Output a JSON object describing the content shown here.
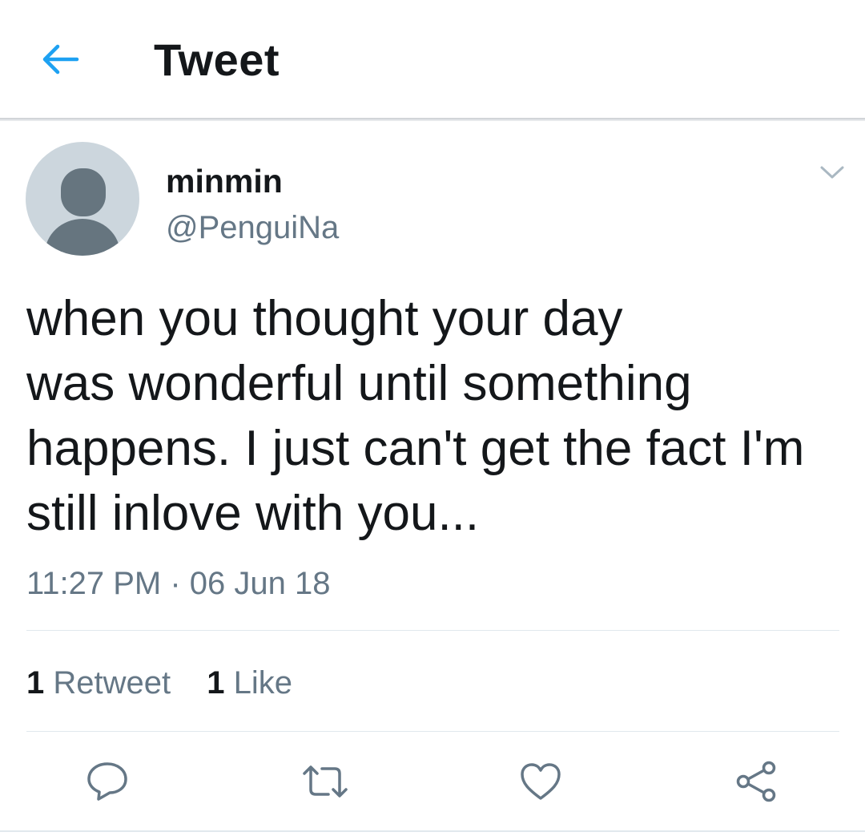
{
  "header": {
    "title": "Tweet",
    "back_icon": "arrow-left-icon",
    "accent_color": "#1da1f2"
  },
  "tweet": {
    "author": {
      "display_name": "minmin",
      "handle": "@PenguiNa",
      "avatar_icon": "default-profile-silhouette"
    },
    "menu_icon": "chevron-down-icon",
    "text_lines": [
      "when you thought your day",
      "was wonderful until something",
      "happens. I just can't get the fact I'm",
      "still inlove with you..."
    ],
    "timestamp": "11:27 PM · 06 Jun 18",
    "stats": {
      "retweet_count": "1",
      "retweet_label": "Retweet",
      "like_count": "1",
      "like_label": "Like"
    },
    "actions": [
      {
        "name": "reply",
        "icon": "speech-bubble-icon"
      },
      {
        "name": "retweet",
        "icon": "retweet-icon"
      },
      {
        "name": "like",
        "icon": "heart-icon"
      },
      {
        "name": "share",
        "icon": "share-icon"
      }
    ]
  },
  "colors": {
    "text_primary": "#14171a",
    "text_secondary": "#657786",
    "divider": "#e1e8ed",
    "avatar_bg": "#ccd6dd",
    "avatar_silhouette": "#66757f"
  }
}
